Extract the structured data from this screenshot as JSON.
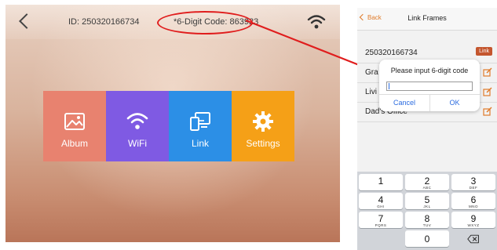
{
  "frame": {
    "id_text": "ID: 250320166734",
    "code_text": "*6-Digit Code: 863923",
    "tiles": [
      {
        "label": "Album",
        "icon": "album-icon",
        "color": "#e8826f"
      },
      {
        "label": "WiFi",
        "icon": "wifi-icon",
        "color": "#7f5ae3"
      },
      {
        "label": "Link",
        "icon": "link-icon",
        "color": "#2c8fe6"
      },
      {
        "label": "Settings",
        "icon": "gear-icon",
        "color": "#f5a017"
      }
    ]
  },
  "phone": {
    "nav": {
      "back_label": "Back",
      "title": "Link Frames"
    },
    "rows": [
      {
        "name": "250320166734",
        "badge": "Link"
      },
      {
        "name": "Gra"
      },
      {
        "name": "Livi"
      },
      {
        "name": "Dad's Office"
      }
    ],
    "dialog": {
      "title": "Please input 6-digit code",
      "input_value": "",
      "cancel_label": "Cancel",
      "ok_label": "OK"
    },
    "keyboard": {
      "keys": [
        {
          "digit": "1",
          "letters": ""
        },
        {
          "digit": "2",
          "letters": "ABC"
        },
        {
          "digit": "3",
          "letters": "DEF"
        },
        {
          "digit": "4",
          "letters": "GHI"
        },
        {
          "digit": "5",
          "letters": "JKL"
        },
        {
          "digit": "6",
          "letters": "MNO"
        },
        {
          "digit": "7",
          "letters": "PQRS"
        },
        {
          "digit": "8",
          "letters": "TUV"
        },
        {
          "digit": "9",
          "letters": "WXYZ"
        },
        {
          "digit": "0",
          "letters": ""
        }
      ],
      "delete_icon": "backspace-icon"
    }
  },
  "colors": {
    "annotation": "#e01d1d",
    "accent": "#e07b2a",
    "ios_blue": "#2a6be0"
  }
}
